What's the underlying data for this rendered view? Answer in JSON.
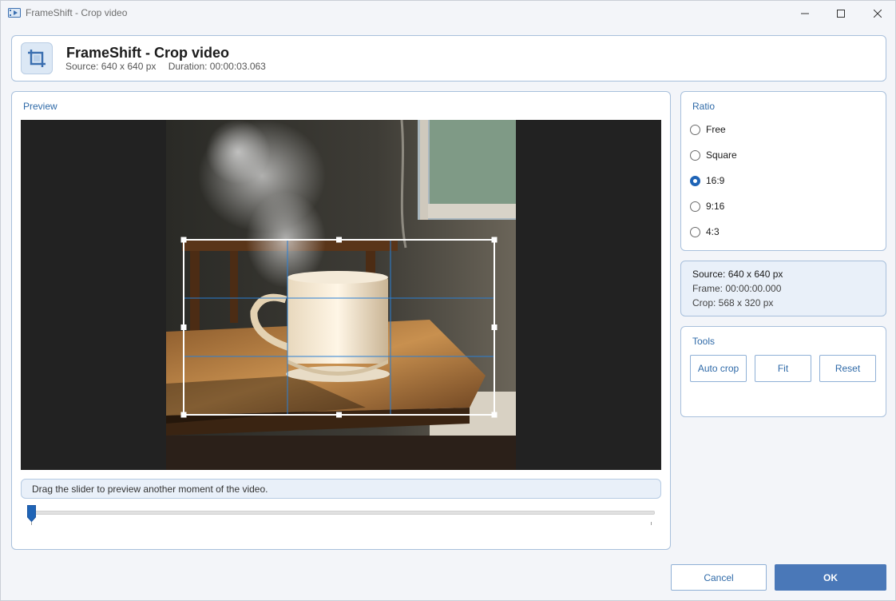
{
  "window": {
    "title": "FrameShift - Crop video"
  },
  "header": {
    "title": "FrameShift - Crop video",
    "source": "Source: 640 x 640 px",
    "duration": "Duration: 00:00:03.063"
  },
  "preview": {
    "label": "Preview",
    "hint": "Drag the slider to preview another moment of the video.",
    "slider_position": 0.0
  },
  "ratio": {
    "label": "Ratio",
    "options": [
      {
        "label": "Free",
        "checked": false
      },
      {
        "label": "Square",
        "checked": false
      },
      {
        "label": "16:9",
        "checked": true
      },
      {
        "label": "9:16",
        "checked": false
      },
      {
        "label": "4:3",
        "checked": false
      }
    ]
  },
  "info": {
    "source": "Source: 640 x 640 px",
    "frame": "Frame: 00:00:00.000",
    "crop": "Crop: 568 x 320 px"
  },
  "tools": {
    "label": "Tools",
    "auto_crop": "Auto crop",
    "fit": "Fit",
    "reset": "Reset"
  },
  "footer": {
    "cancel": "Cancel",
    "ok": "OK"
  },
  "colors": {
    "accent": "#1f64b6",
    "panel_border": "#a8c0dc",
    "primary_button": "#4a78b8",
    "crop_grid": "#2a7fd4"
  }
}
